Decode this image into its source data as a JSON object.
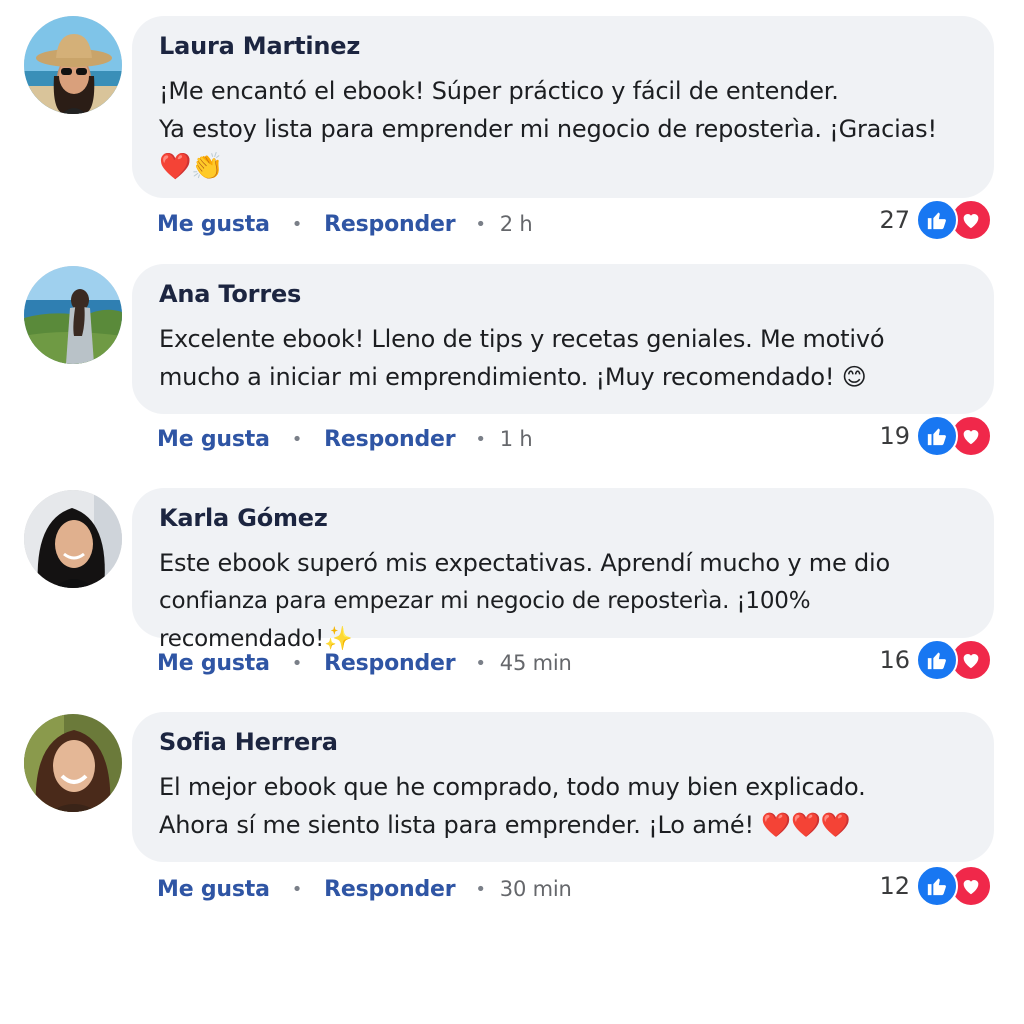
{
  "comments": [
    {
      "author": "Laura Martinez",
      "lines": [
        "¡Me encantó el ebook! Súper práctico y fácil de entender.",
        "Ya estoy lista para emprender mi negocio de reposterìa. ¡Gracias!"
      ],
      "emojis": "❤️👏",
      "like_label": "Me gusta",
      "reply_label": "Responder",
      "time": "2 h",
      "reaction_count": "27",
      "avatar_icon": "woman-with-hat-avatar"
    },
    {
      "author": "Ana Torres",
      "lines": [
        "Excelente ebook! Lleno de tips y recetas geniales. Me motivó",
        "mucho a iniciar mi emprendimiento. ¡Muy recomendado! 😊"
      ],
      "emojis": "",
      "like_label": "Me gusta",
      "reply_label": "Responder",
      "time": "1 h",
      "reaction_count": "19",
      "avatar_icon": "woman-by-sea-avatar"
    },
    {
      "author": "Karla Gómez",
      "lines": [
        "Este ebook superó mis expectativas. Aprendí mucho y me dio",
        "confianza para empezar mi negocio de reposterìa. ¡100% recomendado!✨"
      ],
      "emojis": "",
      "like_label": "Me gusta",
      "reply_label": "Responder",
      "time": "45 min",
      "reaction_count": "16",
      "avatar_icon": "woman-portrait-avatar"
    },
    {
      "author": "Sofia Herrera",
      "lines": [
        "El mejor ebook que he comprado, todo muy bien explicado.",
        "Ahora sí me siento lista para emprender. ¡Lo amé! ❤️❤️❤️"
      ],
      "emojis": "",
      "like_label": "Me gusta",
      "reply_label": "Responder",
      "time": "30 min",
      "reaction_count": "12",
      "avatar_icon": "smiling-woman-avatar"
    }
  ],
  "colors": {
    "bubble": "#f0f2f5",
    "link": "#2f55a4",
    "like": "#1877f2",
    "love": "#f0284a"
  }
}
